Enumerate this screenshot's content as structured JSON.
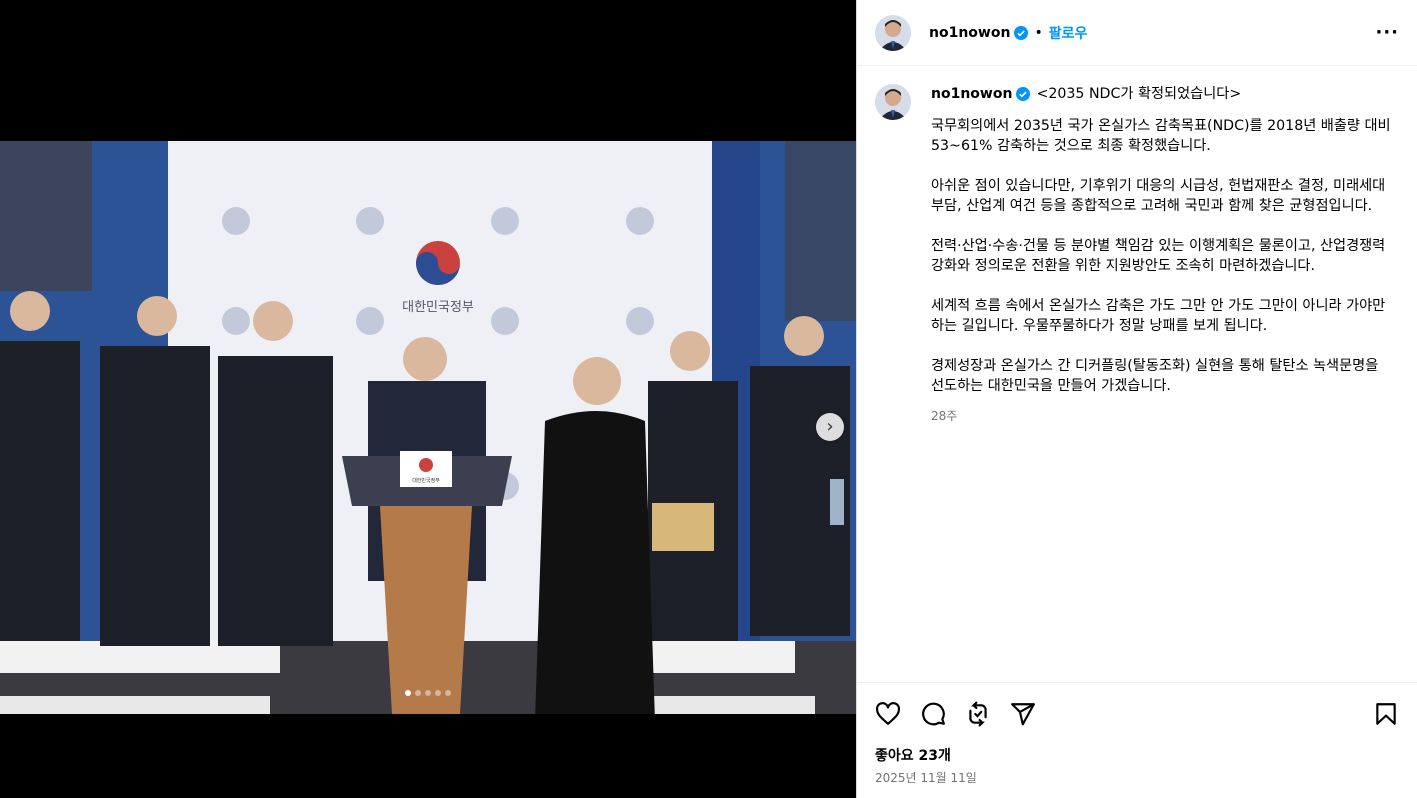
{
  "media": {
    "podium_sign": "대한민국정부",
    "backdrop_logo_text": "대한민국정부",
    "carousel_next_icon": "chevron-right-icon",
    "carousel": {
      "count": 5,
      "active_index": 0
    }
  },
  "header": {
    "username": "no1nowon",
    "separator": "•",
    "follow_label": "팔로우",
    "more_icon": "more-horizontal-icon",
    "more_label": "···"
  },
  "caption": {
    "username": "no1nowon",
    "title": "<2035 NDC가 확정되었습니다>",
    "paragraphs": [
      "국무회의에서 2035년 국가 온실가스 감축목표(NDC)를 2018년 배출량 대비 53~61% 감축하는 것으로 최종 확정했습니다.",
      "아쉬운 점이 있습니다만, 기후위기 대응의 시급성, 헌법재판소 결정, 미래세대 부담, 산업계 여건 등을 종합적으로 고려해 국민과 함께 찾은 균형점입니다.",
      "전력·산업·수송·건물 등 분야별 책임감 있는 이행계획은 물론이고, 산업경쟁력 강화와 정의로운 전환을 위한 지원방안도 조속히 마련하겠습니다.",
      "세계적 흐름 속에서 온실가스 감축은 가도 그만 안 가도 그만이 아니라 가야만 하는 길입니다. 우물쭈물하다가 정말 낭패를 보게 됩니다.",
      "경제성장과 온실가스 간 디커플링(탈동조화) 실현을 통해 탈탄소 녹색문명을 선도하는 대한민국을 만들어 가겠습니다."
    ],
    "age": "28주"
  },
  "footer": {
    "icons": [
      "heart-icon",
      "comment-icon",
      "repost-icon",
      "share-icon",
      "bookmark-icon"
    ],
    "likes": "좋아요 23개",
    "date": "2025년 11월 11일"
  },
  "colors": {
    "accent": "#0095f6",
    "verified": "#0095f6",
    "muted": "#737373"
  }
}
